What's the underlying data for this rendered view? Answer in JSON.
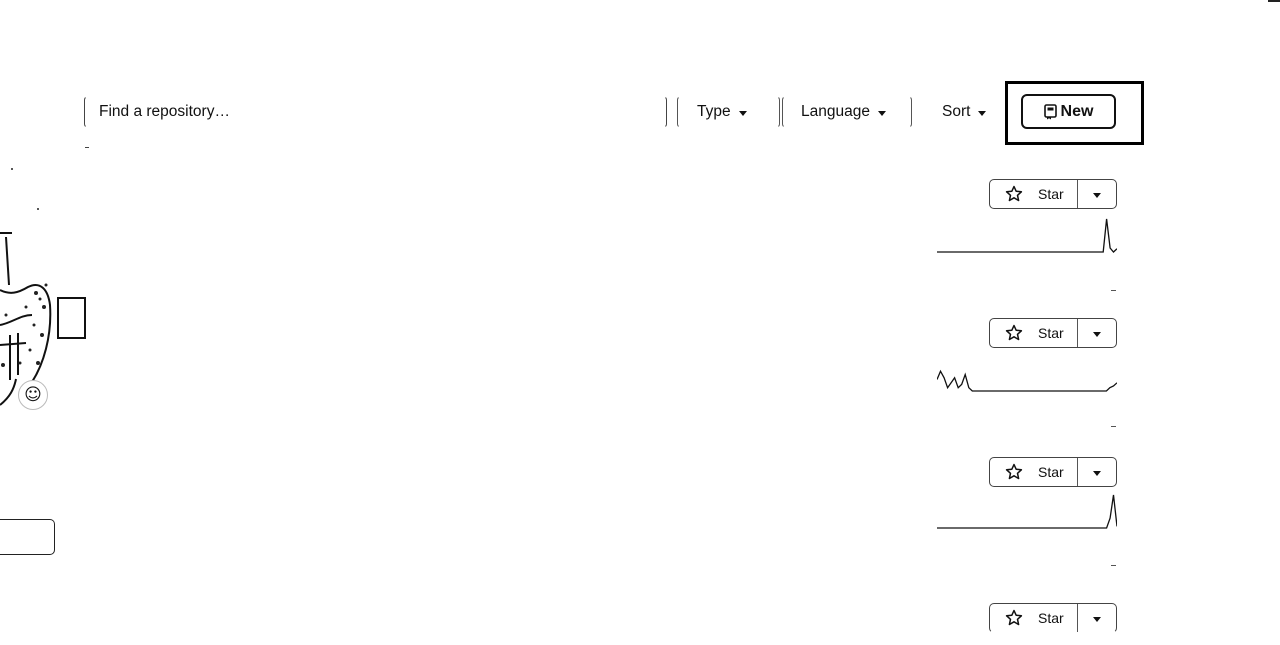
{
  "search": {
    "placeholder": "Find a repository…"
  },
  "filters": {
    "type_label": "Type",
    "language_label": "Language",
    "sort_label": "Sort"
  },
  "new_button": {
    "label": "New"
  },
  "profile": {
    "status_emoji": "☺"
  },
  "repositories": [
    {
      "star_label": "Star",
      "activity": [
        0,
        0,
        0,
        0,
        0,
        0,
        0,
        0,
        0,
        0,
        0,
        0,
        0,
        0,
        0,
        0,
        0,
        0,
        0,
        0,
        0,
        0,
        0,
        0,
        0,
        0,
        0,
        0,
        0,
        0,
        0,
        0,
        0,
        0,
        0,
        0,
        0,
        0,
        0,
        0,
        0,
        0,
        0,
        0,
        0,
        0,
        0,
        0,
        0,
        1,
        0.12,
        0,
        0.1
      ]
    },
    {
      "star_label": "Star",
      "activity": [
        0.35,
        0.6,
        0.4,
        0.1,
        0.25,
        0.4,
        0.1,
        0.2,
        0.5,
        0.1,
        0,
        0,
        0,
        0,
        0,
        0,
        0,
        0,
        0,
        0,
        0,
        0,
        0,
        0,
        0,
        0,
        0,
        0,
        0,
        0,
        0,
        0,
        0,
        0,
        0,
        0,
        0,
        0,
        0,
        0,
        0,
        0,
        0,
        0,
        0,
        0,
        0,
        0,
        0,
        0.1,
        0.15,
        0.25
      ]
    },
    {
      "star_label": "Star",
      "activity": [
        0,
        0,
        0,
        0,
        0,
        0,
        0,
        0,
        0,
        0,
        0,
        0,
        0,
        0,
        0,
        0,
        0,
        0,
        0,
        0,
        0,
        0,
        0,
        0,
        0,
        0,
        0,
        0,
        0,
        0,
        0,
        0,
        0,
        0,
        0,
        0,
        0,
        0,
        0,
        0,
        0,
        0,
        0,
        0,
        0,
        0,
        0,
        0,
        0,
        0,
        0.3,
        1,
        0.05
      ]
    },
    {
      "star_label": "Star",
      "activity": []
    }
  ]
}
